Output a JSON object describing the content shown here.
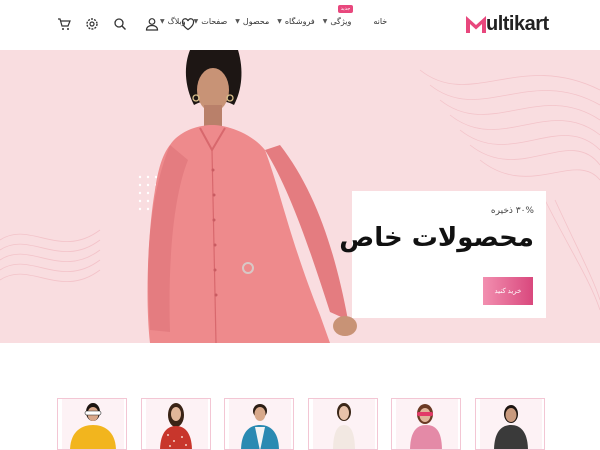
{
  "header": {
    "logo_text": "ultikart",
    "nav": [
      {
        "label": "خانه",
        "has_dropdown": false,
        "badge": ""
      },
      {
        "label": "ویژگی",
        "has_dropdown": true,
        "badge": "جدید"
      },
      {
        "label": "فروشگاه",
        "has_dropdown": true,
        "badge": ""
      },
      {
        "label": "محصول",
        "has_dropdown": true,
        "badge": ""
      },
      {
        "label": "صفحات",
        "has_dropdown": true,
        "badge": ""
      },
      {
        "label": "وبلاگ",
        "has_dropdown": true,
        "badge": ""
      }
    ],
    "icons": [
      "cart-icon",
      "settings-icon",
      "search-icon",
      "user-icon",
      "heart-icon"
    ]
  },
  "hero": {
    "save_text": "۳۰% ذخیره",
    "title": "محصولات خاص",
    "button_label": "خرید کنید"
  },
  "products": [
    {
      "name": "product-card-1",
      "shirt": "#3a3a3a",
      "skin": "#c99a7e",
      "hair": "#1d1612"
    },
    {
      "name": "product-card-2",
      "shirt": "#e48aa7",
      "skin": "#e0b49a",
      "hair": "#6b3a24"
    },
    {
      "name": "product-card-3",
      "shirt": "#f2e8e2",
      "skin": "#e8c2aa",
      "hair": "#3b2718"
    },
    {
      "name": "product-card-4",
      "shirt": "#2a8ab2",
      "skin": "#d8a98b",
      "hair": "#2b1d14"
    },
    {
      "name": "product-card-5",
      "shirt": "#c8362c",
      "skin": "#e2b79a",
      "hair": "#3a2416"
    },
    {
      "name": "product-card-6",
      "shirt": "#f2b51e",
      "skin": "#d9a78a",
      "hair": "#1c1410"
    }
  ],
  "colors": {
    "accent": "#e8477d",
    "hero_bg": "#f9dde0",
    "dress": "#ee8a8c"
  }
}
